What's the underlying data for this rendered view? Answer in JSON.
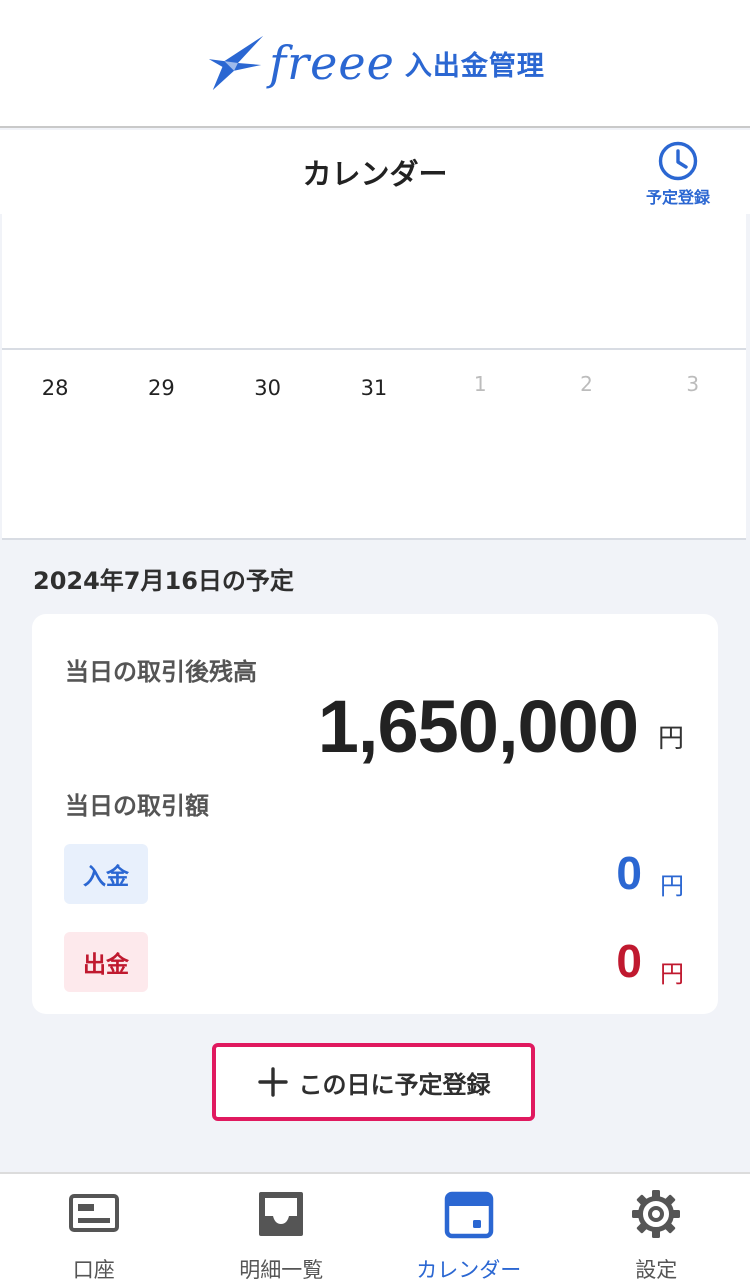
{
  "header": {
    "logo_word": "freee",
    "logo_sub": "入出金管理"
  },
  "title_bar": {
    "title": "カレンダー",
    "schedule_label": "予定登録"
  },
  "calendar": {
    "week": [
      {
        "day": "28",
        "muted": false
      },
      {
        "day": "29",
        "muted": false
      },
      {
        "day": "30",
        "muted": false
      },
      {
        "day": "31",
        "muted": false
      },
      {
        "day": "1",
        "muted": true
      },
      {
        "day": "2",
        "muted": true
      },
      {
        "day": "3",
        "muted": true
      }
    ]
  },
  "schedule": {
    "heading": "2024年7月16日の予定",
    "balance_label": "当日の取引後残高",
    "balance": "1,650,000",
    "currency": "円",
    "amount_label": "当日の取引額",
    "deposit_label": "入金",
    "deposit_amount": "0",
    "withdrawal_label": "出金",
    "withdrawal_amount": "0"
  },
  "add_button": {
    "label": "この日に予定登録"
  },
  "tabs": [
    {
      "label": "口座",
      "icon": "account-icon",
      "active": false
    },
    {
      "label": "明細一覧",
      "icon": "inbox-icon",
      "active": false
    },
    {
      "label": "カレンダー",
      "icon": "calendar-icon",
      "active": true
    },
    {
      "label": "設定",
      "icon": "gear-icon",
      "active": false
    }
  ],
  "colors": {
    "brand": "#2b67d2",
    "deposit": "#2b67d2",
    "withdrawal": "#c0192f",
    "highlight": "#e0195f"
  }
}
